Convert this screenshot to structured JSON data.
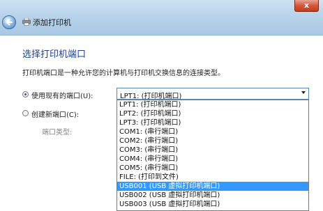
{
  "window": {
    "title": "添加打印机",
    "close_label": "x"
  },
  "page": {
    "heading": "选择打印机端口",
    "description": "打印机端口是一种允许您的计算机与打印机交换信息的连接类型。"
  },
  "options": {
    "use_existing": {
      "label": "使用现有的端口(U):",
      "checked": true
    },
    "create_new": {
      "label": "创建新端口(C):",
      "checked": false
    },
    "port_type_label": "端口类型:"
  },
  "combo": {
    "selected": "LPT1: (打印机端口)"
  },
  "dropdown_items": [
    "LPT1: (打印机端口)",
    "LPT2: (打印机端口)",
    "LPT3: (打印机端口)",
    "COM1: (串行端口)",
    "COM2: (串行端口)",
    "COM3: (串行端口)",
    "COM4: (串行端口)",
    "COM5: (串行端口)",
    "FILE: (打印到文件)",
    "USB001 (USB 虚拟打印机端口)",
    "USB002 (USB 虚拟打印机端口)",
    "USB003 (USB 虚拟打印机端口)"
  ],
  "highlighted_index": 9,
  "icons": {
    "back": "back-arrow-icon",
    "printer": "printer-icon"
  }
}
